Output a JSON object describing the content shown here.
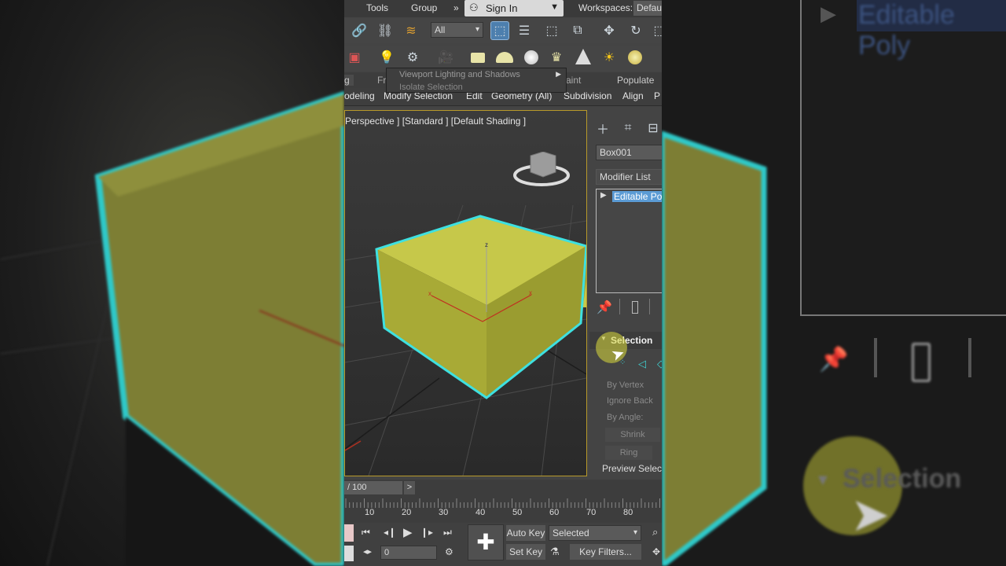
{
  "menubar": {
    "tools": "Tools",
    "group": "Group",
    "more": "»",
    "signin": "Sign In",
    "workspaces_label": "Workspaces:",
    "workspaces_value": "Defau"
  },
  "toolbar": {
    "filter_value": "All"
  },
  "tooltip": {
    "line1": "Viewport Lighting and Shadows",
    "line2": "Isolate Selection"
  },
  "ribbon": {
    "tabs": [
      "g",
      "Fr",
      "aint",
      "Populate"
    ],
    "sub": [
      "odeling",
      "Modify Selection",
      "Edit",
      "Geometry (All)",
      "Subdivision",
      "Align",
      "P"
    ]
  },
  "viewport": {
    "label": "Perspective ] [Standard ] [Default Shading ]"
  },
  "command_panel": {
    "object_name": "Box001",
    "modifier_list": "Modifier List",
    "stack_item": "Editable Poly",
    "rollout_title": "Selection",
    "by_vertex": "By Vertex",
    "ignore_back": "Ignore Back",
    "by_angle": "By Angle:",
    "shrink": "Shrink",
    "ring": "Ring",
    "preview": "Preview Selecti"
  },
  "timeline": {
    "frame_readout": "/ 100",
    "next": ">",
    "ticks": [
      "10",
      "20",
      "30",
      "40",
      "50",
      "60",
      "70",
      "80"
    ],
    "auto_key": "Auto Key",
    "set_key": "Set Key",
    "selected": "Selected",
    "key_filters": "Key Filters...",
    "frame_value": "0"
  },
  "background": {
    "left_text": "",
    "right_title": "Editable Poly",
    "right_selection": "Selection"
  },
  "colors": {
    "accent_select": "#5b9bd5",
    "box_fill": "#c9cb4c",
    "edge_highlight": "#3ee0e0",
    "viewport_border": "#b89a2a"
  }
}
